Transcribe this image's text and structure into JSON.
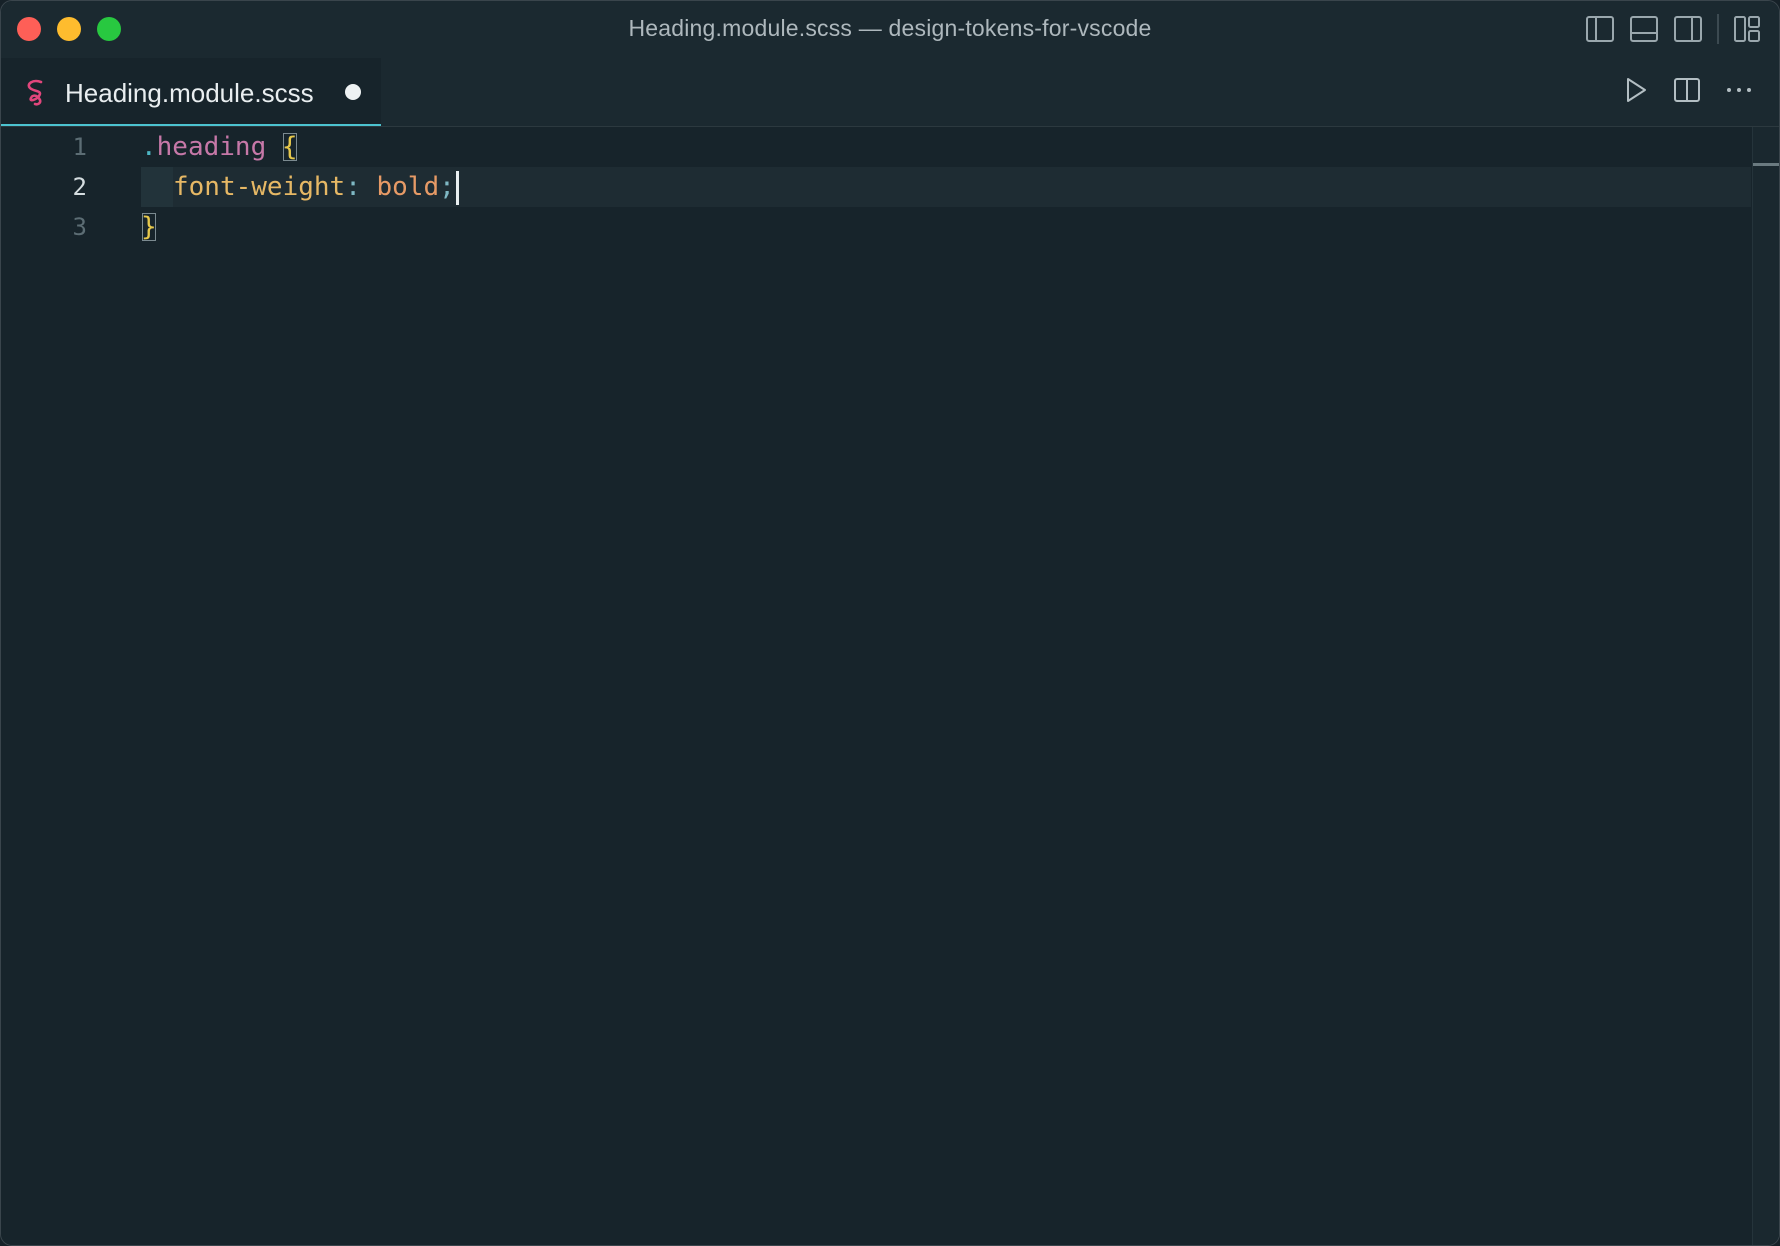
{
  "window": {
    "title": "Heading.module.scss — design-tokens-for-vscode"
  },
  "tab": {
    "label": "Heading.module.scss",
    "icon": "sass-icon",
    "modified": true
  },
  "editor": {
    "line_numbers": [
      "1",
      "2",
      "3"
    ],
    "active_line": 2,
    "lines": {
      "l1": {
        "dot": ".",
        "selector": "heading",
        "space": " ",
        "brace": "{"
      },
      "l2": {
        "property": "font-weight",
        "colon": ":",
        "space": " ",
        "value": "bold",
        "semi": ";"
      },
      "l3": {
        "brace": "}"
      }
    }
  },
  "icons": {
    "layout": [
      "toggle-primary-sidebar-icon",
      "toggle-panel-icon",
      "toggle-secondary-sidebar-icon",
      "customize-layout-icon"
    ],
    "tab_actions": [
      "run-icon",
      "split-editor-icon",
      "more-actions-icon"
    ]
  },
  "colors": {
    "background": "#17242b",
    "accent": "#4cc3d0",
    "selector": "#c678a8",
    "property": "#e6b865",
    "value": "#e69a66",
    "brace": "#e6c84c"
  }
}
